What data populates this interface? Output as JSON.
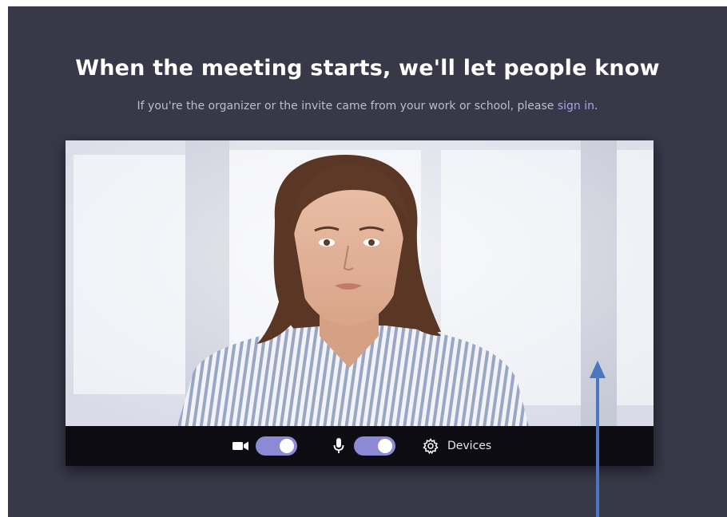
{
  "join_screen": {
    "headline": "When the meeting starts, we'll let people know",
    "subline_prefix": "If you're the organizer or the invite came from your work or school, please ",
    "sign_in_link": "sign in",
    "subline_suffix": "."
  },
  "controls": {
    "camera": {
      "icon": "camera-icon",
      "on": true
    },
    "microphone": {
      "icon": "microphone-icon",
      "on": true
    },
    "devices_label": "Devices",
    "devices_icon": "gear-icon"
  },
  "colors": {
    "background": "#393849",
    "toggle_on": "#8c8ad4",
    "link": "#a7a4e6",
    "arrow": "#4a76c2"
  }
}
